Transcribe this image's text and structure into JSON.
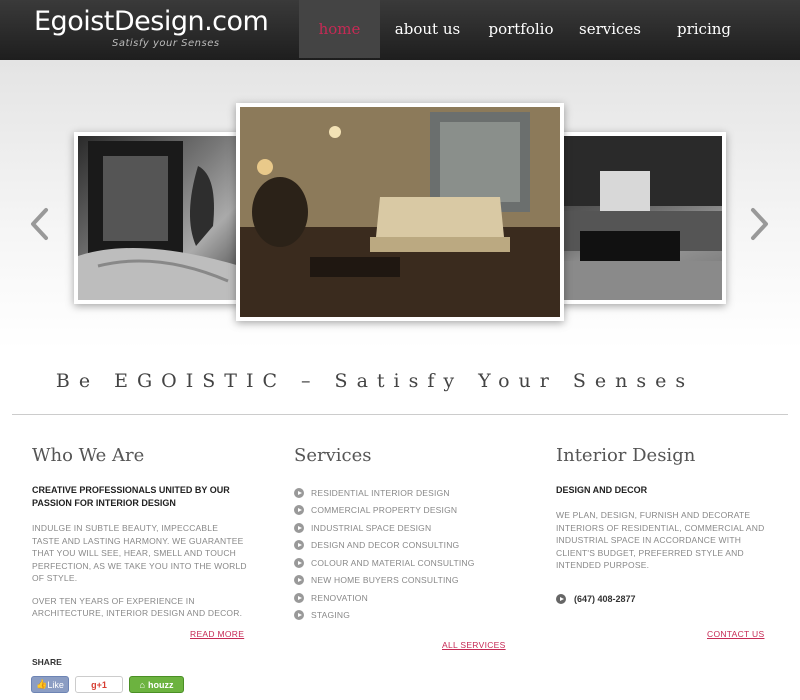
{
  "header": {
    "logo": "EgoistDesign.com",
    "tagline": "Satisfy your Senses",
    "nav": [
      {
        "label": "home",
        "active": true
      },
      {
        "label": "about us",
        "active": false
      },
      {
        "label": "portfolio",
        "active": false
      },
      {
        "label": "services",
        "active": false
      },
      {
        "label": "pricing",
        "active": false
      }
    ]
  },
  "slider": {
    "prev_icon": "chevron-left-icon",
    "next_icon": "chevron-right-icon"
  },
  "tagline": "Be EGOISTIC – Satisfy Your Senses",
  "who_we_are": {
    "title": "Who We Are",
    "subtitle": "CREATIVE PROFESSIONALS UNITED BY OUR PASSION FOR INTERIOR DESIGN",
    "para1": "INDULGE IN SUBTLE BEAUTY, IMPECCABLE TASTE AND LASTING HARMONY. WE GUARANTEE THAT YOU WILL SEE, HEAR, SMELL AND TOUCH PERFECTION, AS WE TAKE YOU INTO THE WORLD OF STYLE.",
    "para2": "OVER TEN YEARS OF EXPERIENCE IN ARCHITECTURE, INTERIOR DESIGN AND DECOR.",
    "link": "READ MORE"
  },
  "services": {
    "title": "Services",
    "items": [
      "RESIDENTIAL INTERIOR DESIGN",
      "COMMERCIAL PROPERTY DESIGN",
      "INDUSTRIAL SPACE DESIGN",
      "DESIGN AND DECOR CONSULTING",
      "COLOUR AND MATERIAL CONSULTING",
      "NEW HOME BUYERS CONSULTING",
      "RENOVATION",
      "STAGING"
    ],
    "link": "ALL SERVICES"
  },
  "interior": {
    "title": "Interior Design",
    "subtitle": "DESIGN AND DECOR",
    "para": "WE PLAN, DESIGN, FURNISH AND DECORATE INTERIORS OF RESIDENTIAL, COMMERCIAL AND INDUSTRIAL SPACE IN ACCORDANCE WITH CLIENT'S BUDGET, PREFERRED STYLE AND INTENDED PURPOSE.",
    "phone": "(647) 408-2877",
    "link": "CONTACT US"
  },
  "share": {
    "label": "SHARE",
    "like": "Like",
    "gplus": "g+1",
    "houzz": "houzz"
  },
  "colors": {
    "accent": "#c62a55",
    "header_bg": "#2b2b2b"
  }
}
